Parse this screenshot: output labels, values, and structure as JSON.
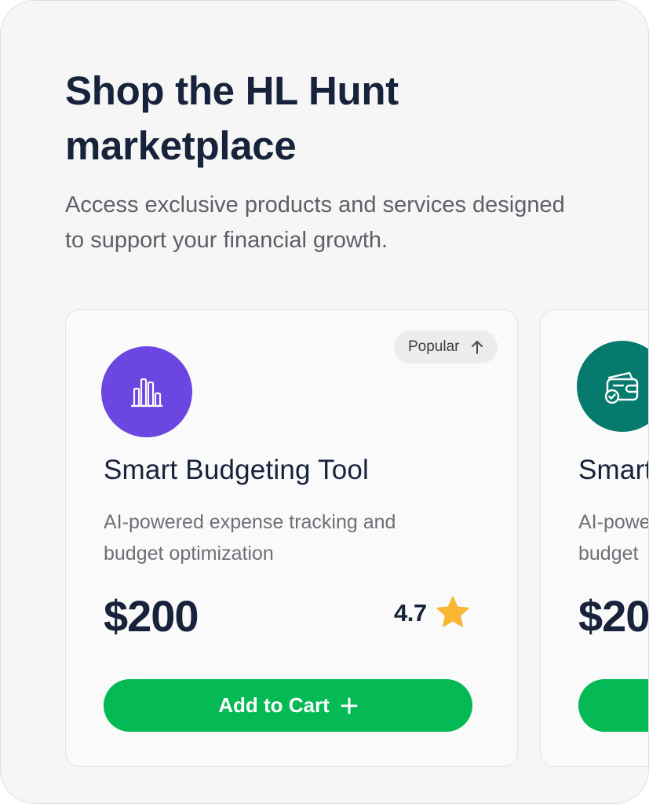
{
  "header": {
    "title": "Shop the HL Hunt marketplace",
    "subtitle": "Access exclusive products and services designed to support your financial growth."
  },
  "colors": {
    "primary_text": "#17223b",
    "secondary_text": "#5b5f66",
    "button_green": "#05b954",
    "star": "#f7b733"
  },
  "products": [
    {
      "badge": "Popular",
      "badge_icon": "arrow-up-icon",
      "icon": "bar-chart-icon",
      "icon_color": "#6c46e0",
      "name": "Smart Budgeting Tool",
      "description": "AI-powered expense tracking and budget optimization",
      "price": "$200",
      "rating": "4.7",
      "rating_icon": "star-icon",
      "cta_label": "Add to Cart",
      "cta_icon": "plus-icon"
    },
    {
      "icon": "wallet-check-icon",
      "icon_color": "#077a6e",
      "name_visible": "Smart",
      "description_visible": "AI-powe budget",
      "price_visible": "$20"
    }
  ]
}
